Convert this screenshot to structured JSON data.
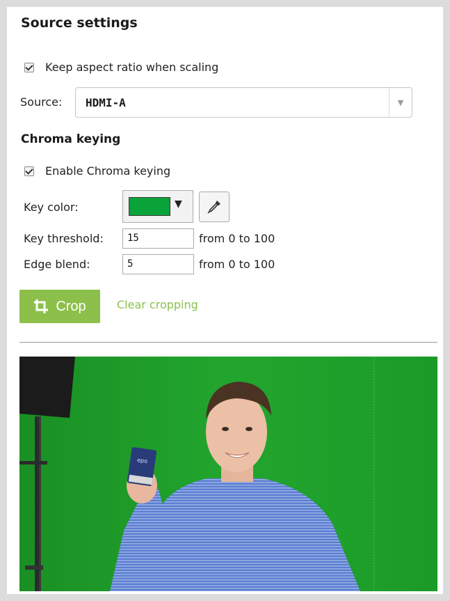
{
  "panel": {
    "title": "Source settings",
    "keep_aspect": {
      "label": "Keep aspect ratio when scaling",
      "checked": true
    },
    "source": {
      "label": "Source:",
      "value": "HDMI-A"
    },
    "chroma": {
      "heading": "Chroma keying",
      "enable": {
        "label": "Enable Chroma keying",
        "checked": true
      },
      "key_color": {
        "label": "Key color:",
        "color": "#0aa33a"
      },
      "key_threshold": {
        "label": "Key threshold:",
        "value": "15",
        "range": "from 0 to 100"
      },
      "edge_blend": {
        "label": "Edge blend:",
        "value": "5",
        "range": "from 0 to 100"
      }
    },
    "crop": {
      "button_label": "Crop",
      "clear_link": "Clear cropping"
    }
  },
  "colors": {
    "accent_green": "#8cc04b",
    "chroma_green": "#1f9d2a"
  },
  "icons": [
    "checkbox-checked-icon",
    "dropdown-arrow-icon",
    "eyedropper-icon",
    "crop-icon"
  ]
}
